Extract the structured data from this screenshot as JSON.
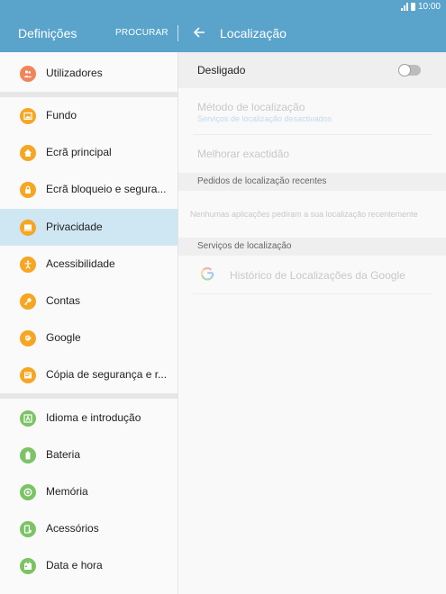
{
  "status_bar": {
    "time": "10:00"
  },
  "app_bar": {
    "title": "Definições",
    "search_label": "PROCURAR",
    "right_title": "Localização"
  },
  "sidebar": {
    "items": [
      {
        "label": "Utilizadores",
        "icon": "users-icon",
        "color": "#f2845c"
      },
      {
        "label": "Fundo",
        "icon": "wallpaper-icon",
        "color": "#f6a623"
      },
      {
        "label": "Ecrã principal",
        "icon": "home-icon",
        "color": "#f6a623"
      },
      {
        "label": "Ecrã bloqueio e segura...",
        "icon": "lock-icon",
        "color": "#f6a623"
      },
      {
        "label": "Privacidade",
        "icon": "privacy-icon",
        "color": "#f6a623",
        "active": true
      },
      {
        "label": "Acessibilidade",
        "icon": "accessibility-icon",
        "color": "#f6a623"
      },
      {
        "label": "Contas",
        "icon": "key-icon",
        "color": "#f6a623"
      },
      {
        "label": "Google",
        "icon": "google-g-icon",
        "color": "#f6a623"
      },
      {
        "label": "Cópia de segurança e r...",
        "icon": "backup-icon",
        "color": "#f6a623"
      },
      {
        "label": "Idioma e introdução",
        "icon": "language-icon",
        "color": "#7cc365"
      },
      {
        "label": "Bateria",
        "icon": "battery-icon",
        "color": "#7cc365"
      },
      {
        "label": "Memória",
        "icon": "memory-icon",
        "color": "#7cc365"
      },
      {
        "label": "Acessórios",
        "icon": "accessories-icon",
        "color": "#7cc365"
      },
      {
        "label": "Data e hora",
        "icon": "calendar-icon",
        "color": "#7cc365"
      }
    ]
  },
  "location": {
    "master_label": "Desligado",
    "master_on": false,
    "method_title": "Método de localização",
    "method_sub": "Serviços de localização desactivados",
    "improve_label": "Melhorar exactidão",
    "recent_header": "Pedidos de localização recentes",
    "empty_message": "Nenhumas aplicações pediram a sua localização recentemente",
    "services_header": "Serviços de localização",
    "google_history": "Histórico de Localizações da Google"
  },
  "colors": {
    "accent": "#5aa3cb",
    "active_row": "#cfe6f3"
  }
}
